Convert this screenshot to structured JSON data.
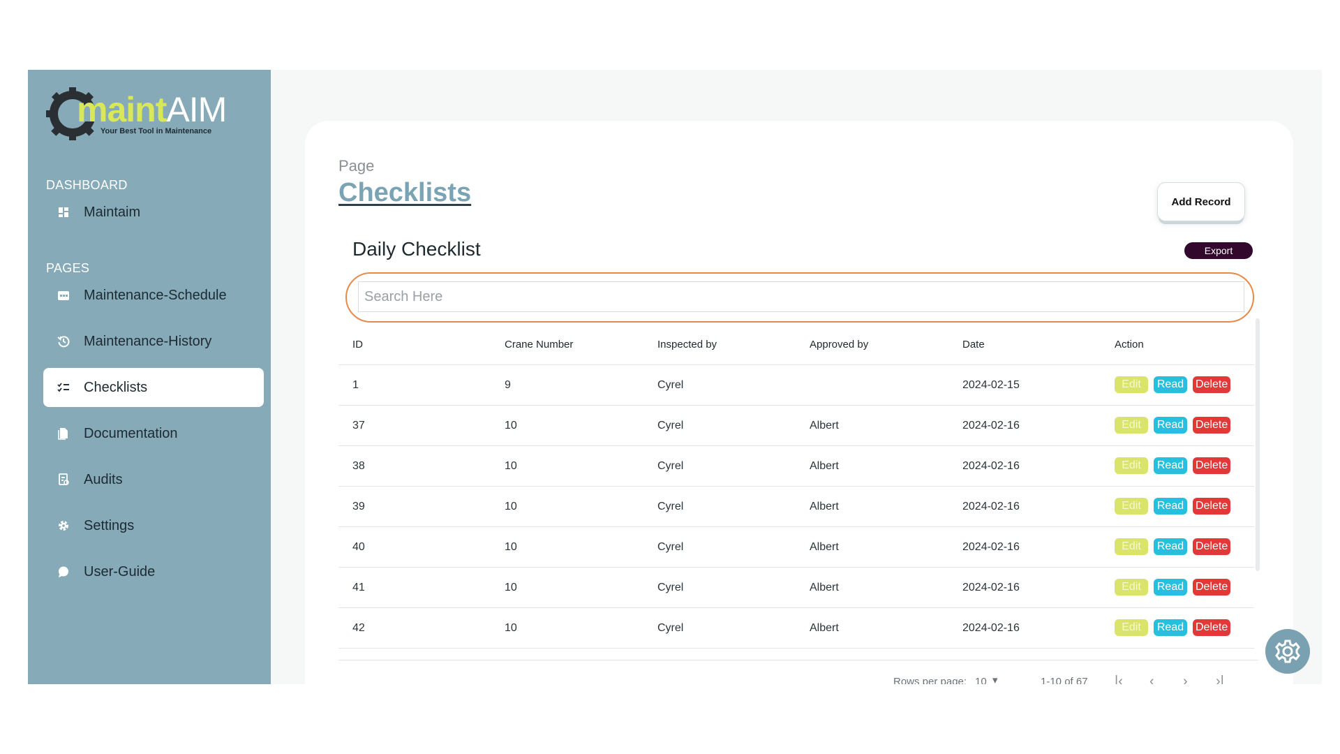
{
  "brand": {
    "name_part1": "maint",
    "name_part2": "AIM",
    "tagline": "Your Best Tool in Maintenance"
  },
  "sidebar": {
    "sections": [
      {
        "label": "DASHBOARD"
      },
      {
        "label": "PAGES"
      }
    ],
    "items": [
      {
        "label": "Maintaim",
        "icon": "dashboard-icon",
        "active": false
      },
      {
        "label": "Maintenance-Schedule",
        "icon": "calendar-icon",
        "active": false
      },
      {
        "label": "Maintenance-History",
        "icon": "history-icon",
        "active": false
      },
      {
        "label": "Checklists",
        "icon": "checklist-icon",
        "active": true
      },
      {
        "label": "Documentation",
        "icon": "document-icon",
        "active": false
      },
      {
        "label": "Audits",
        "icon": "audit-icon",
        "active": false
      },
      {
        "label": "Settings",
        "icon": "gear-icon",
        "active": false
      },
      {
        "label": "User-Guide",
        "icon": "chat-bubble-icon",
        "active": false
      }
    ]
  },
  "header": {
    "kicker": "Page",
    "title": "Checklists",
    "add_button": "Add Record"
  },
  "table": {
    "title": "Daily Checklist",
    "export_label": "Export",
    "search_placeholder": "Search Here",
    "columns": [
      "ID",
      "Crane Number",
      "Inspected by",
      "Approved by",
      "Date",
      "Action"
    ],
    "rows": [
      {
        "id": "1",
        "crane": "9",
        "inspected": "Cyrel",
        "approved": "",
        "date": "2024-02-15"
      },
      {
        "id": "37",
        "crane": "10",
        "inspected": "Cyrel",
        "approved": "Albert",
        "date": "2024-02-16"
      },
      {
        "id": "38",
        "crane": "10",
        "inspected": "Cyrel",
        "approved": "Albert",
        "date": "2024-02-16"
      },
      {
        "id": "39",
        "crane": "10",
        "inspected": "Cyrel",
        "approved": "Albert",
        "date": "2024-02-16"
      },
      {
        "id": "40",
        "crane": "10",
        "inspected": "Cyrel",
        "approved": "Albert",
        "date": "2024-02-16"
      },
      {
        "id": "41",
        "crane": "10",
        "inspected": "Cyrel",
        "approved": "Albert",
        "date": "2024-02-16"
      },
      {
        "id": "42",
        "crane": "10",
        "inspected": "Cyrel",
        "approved": "Albert",
        "date": "2024-02-16"
      }
    ],
    "action_labels": {
      "edit": "Edit",
      "read": "Read",
      "delete": "Delete"
    },
    "pagination": {
      "rows_per_page_label": "Rows per page:",
      "rows_per_page_value": "10",
      "range": "1-10 of 67"
    }
  },
  "colors": {
    "sidebar_bg": "#86aab7",
    "accent": "#7aa3b4",
    "search_ring": "#e58a4a",
    "export_bg": "#32082c",
    "edit": "#dae46a",
    "read": "#26c0de",
    "delete": "#e23838"
  }
}
